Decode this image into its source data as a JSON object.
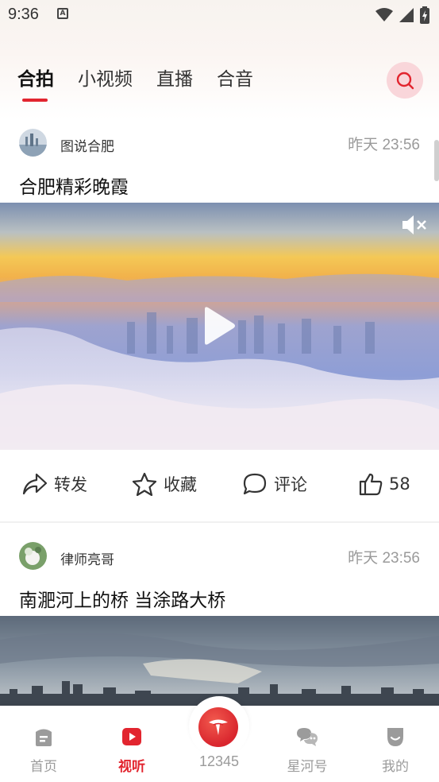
{
  "status_bar": {
    "time": "9:36",
    "notification_icon": "a-icon"
  },
  "tabs": [
    {
      "label": "合拍",
      "active": true
    },
    {
      "label": "小视频",
      "active": false
    },
    {
      "label": "直播",
      "active": false
    },
    {
      "label": "合音",
      "active": false
    }
  ],
  "posts": [
    {
      "author": "图说合肥",
      "time": "昨天  23:56",
      "title": "合肥精彩晚霞",
      "actions": {
        "share": "转发",
        "favorite": "收藏",
        "comment": "评论",
        "likes": "58"
      }
    },
    {
      "author": "律师亮哥",
      "time": "昨天  23:56",
      "title": "南淝河上的桥  当涂路大桥"
    }
  ],
  "bottom_nav": [
    {
      "label": "首页",
      "icon": "home-icon",
      "active": false
    },
    {
      "label": "视听",
      "icon": "video-icon",
      "active": true
    },
    {
      "label": "12345",
      "icon": "hotline-icon",
      "active": false
    },
    {
      "label": "星河号",
      "icon": "chat-icon",
      "active": false
    },
    {
      "label": "我的",
      "icon": "profile-icon",
      "active": false
    }
  ],
  "colors": {
    "accent": "#e2252f",
    "muted": "#9b9b9b"
  }
}
